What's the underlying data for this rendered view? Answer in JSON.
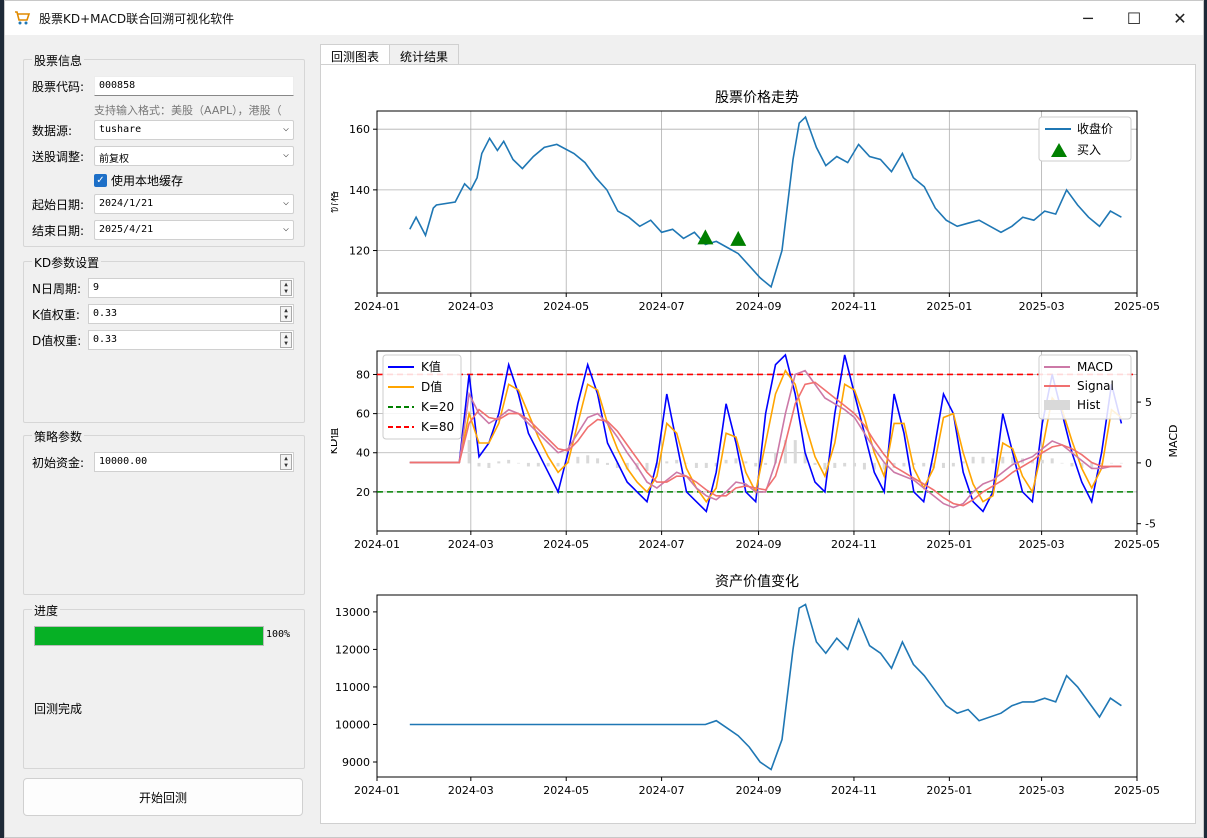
{
  "window": {
    "title": "股票KD+MACD联合回溯可视化软件",
    "minimize_icon": "minimize-icon",
    "maximize_icon": "maximize-icon",
    "close_icon": "close-icon"
  },
  "stock_info": {
    "group_title": "股票信息",
    "code_label": "股票代码:",
    "code_value": "000858",
    "hint": "支持输入格式：美股（AAPL），港股（",
    "source_label": "数据源:",
    "source_value": "tushare",
    "adjust_label": "送股调整:",
    "adjust_value": "前复权",
    "cache_label": "使用本地缓存",
    "cache_checked": true,
    "start_label": "起始日期:",
    "start_value": "2024/1/21",
    "end_label": "结束日期:",
    "end_value": "2025/4/21"
  },
  "kd_params": {
    "group_title": "KD参数设置",
    "n_label": "N日周期:",
    "n_value": "9",
    "k_label": "K值权重:",
    "k_value": "0.33",
    "d_label": "D值权重:",
    "d_value": "0.33"
  },
  "strategy": {
    "group_title": "策略参数",
    "capital_label": "初始资金:",
    "capital_value": "10000.00"
  },
  "progress": {
    "group_title": "进度",
    "percent": 100,
    "percent_text": "100%",
    "status": "回测完成"
  },
  "start_button": "开始回测",
  "tabs": [
    {
      "label": "回测图表",
      "active": true
    },
    {
      "label": "统计结果",
      "active": false
    }
  ],
  "chart_data": [
    {
      "type": "line",
      "title": "股票价格走势",
      "ylabel": "价格",
      "xlabel": "",
      "x_ticks": [
        "2024-01",
        "2024-03",
        "2024-05",
        "2024-07",
        "2024-09",
        "2024-11",
        "2025-01",
        "2025-03",
        "2025-05"
      ],
      "ylim": [
        106,
        166
      ],
      "y_ticks": [
        120,
        140,
        160
      ],
      "legend": {
        "placement": "top-right",
        "entries": [
          "收盘价",
          "买入"
        ]
      },
      "grid": true,
      "series": [
        {
          "name": "收盘价",
          "color": "#1f77b4",
          "x": [
            "2024-01-22",
            "2024-01-26",
            "2024-02-01",
            "2024-02-06",
            "2024-02-08",
            "2024-02-20",
            "2024-02-26",
            "2024-03-01",
            "2024-03-05",
            "2024-03-08",
            "2024-03-13",
            "2024-03-18",
            "2024-03-22",
            "2024-03-28",
            "2024-04-03",
            "2024-04-10",
            "2024-04-17",
            "2024-04-25",
            "2024-05-06",
            "2024-05-13",
            "2024-05-20",
            "2024-05-27",
            "2024-06-03",
            "2024-06-10",
            "2024-06-17",
            "2024-06-24",
            "2024-07-01",
            "2024-07-08",
            "2024-07-15",
            "2024-07-22",
            "2024-07-29",
            "2024-08-05",
            "2024-08-12",
            "2024-08-19",
            "2024-08-26",
            "2024-09-02",
            "2024-09-09",
            "2024-09-16",
            "2024-09-23",
            "2024-09-27",
            "2024-10-01",
            "2024-10-08",
            "2024-10-14",
            "2024-10-21",
            "2024-10-28",
            "2024-11-04",
            "2024-11-11",
            "2024-11-18",
            "2024-11-25",
            "2024-12-02",
            "2024-12-09",
            "2024-12-16",
            "2024-12-23",
            "2024-12-30",
            "2025-01-06",
            "2025-01-13",
            "2025-01-20",
            "2025-02-03",
            "2025-02-10",
            "2025-02-17",
            "2025-02-24",
            "2025-03-03",
            "2025-03-10",
            "2025-03-17",
            "2025-03-24",
            "2025-03-31",
            "2025-04-07",
            "2025-04-14",
            "2025-04-21"
          ],
          "y": [
            127,
            131,
            125,
            134,
            135,
            136,
            142,
            140,
            144,
            152,
            157,
            153,
            156,
            150,
            147,
            151,
            154,
            155,
            152,
            149,
            144,
            140,
            133,
            131,
            128,
            130,
            126,
            127,
            124,
            126,
            122,
            123,
            121,
            119,
            115,
            111,
            108,
            120,
            150,
            162,
            164,
            154,
            148,
            151,
            149,
            155,
            151,
            150,
            146,
            152,
            144,
            141,
            134,
            130,
            128,
            129,
            130,
            126,
            128,
            131,
            130,
            133,
            132,
            140,
            135,
            131,
            128,
            133,
            131
          ]
        }
      ],
      "markers": [
        {
          "name": "买入",
          "color": "#008000",
          "x": [
            "2024-07-29",
            "2024-08-19"
          ],
          "y": [
            124,
            123.5
          ]
        }
      ]
    },
    {
      "type": "line",
      "title": "",
      "ylabel": "KD值",
      "y2label": "MACD",
      "x_ticks": [
        "2024-01",
        "2024-03",
        "2024-05",
        "2024-07",
        "2024-09",
        "2024-11",
        "2025-01",
        "2025-03",
        "2025-05"
      ],
      "ylim": [
        0,
        92
      ],
      "y_ticks": [
        20,
        40,
        60,
        80
      ],
      "y2lim": [
        -5.6,
        9.2
      ],
      "y2_ticks": [
        -5,
        0,
        5
      ],
      "legend_left": [
        "K值",
        "D值",
        "K=20",
        "K=80"
      ],
      "legend_right": [
        "MACD",
        "Signal",
        "Hist"
      ],
      "grid": true,
      "hlines": [
        {
          "name": "K=20",
          "y": 20,
          "color": "#008000"
        },
        {
          "name": "K=80",
          "y": 80,
          "color": "#ff0000"
        }
      ],
      "series": [
        {
          "name": "K值",
          "color": "#0000ff",
          "y": [
            35,
            35,
            35,
            35,
            35,
            35,
            80,
            38,
            45,
            60,
            85,
            70,
            50,
            40,
            30,
            20,
            40,
            65,
            85,
            70,
            45,
            35,
            25,
            20,
            15,
            35,
            70,
            45,
            20,
            15,
            10,
            30,
            65,
            45,
            20,
            15,
            60,
            85,
            90,
            70,
            40,
            25,
            20,
            60,
            90,
            70,
            50,
            30,
            20,
            70,
            50,
            20,
            15,
            40,
            70,
            60,
            30,
            15,
            10,
            20,
            60,
            40,
            20,
            15,
            55,
            80,
            60,
            40,
            25,
            15,
            40,
            75,
            55
          ]
        },
        {
          "name": "D值",
          "color": "#ffa500",
          "y": [
            35,
            35,
            35,
            35,
            35,
            35,
            60,
            45,
            45,
            55,
            75,
            72,
            60,
            48,
            38,
            30,
            35,
            55,
            75,
            72,
            55,
            42,
            32,
            25,
            20,
            28,
            55,
            50,
            32,
            22,
            15,
            22,
            50,
            48,
            30,
            20,
            45,
            70,
            82,
            75,
            55,
            38,
            28,
            45,
            75,
            72,
            58,
            40,
            28,
            55,
            55,
            32,
            22,
            32,
            58,
            60,
            40,
            24,
            15,
            18,
            45,
            42,
            28,
            20,
            42,
            68,
            62,
            46,
            32,
            22,
            32,
            62,
            58
          ]
        },
        {
          "name": "MACD",
          "color": "#cc79a7",
          "y": [
            35,
            35,
            35,
            35,
            35,
            35,
            70,
            60,
            55,
            58,
            62,
            60,
            55,
            50,
            45,
            40,
            42,
            50,
            58,
            60,
            55,
            48,
            40,
            33,
            25,
            22,
            26,
            30,
            28,
            22,
            18,
            16,
            20,
            25,
            24,
            20,
            20,
            35,
            60,
            80,
            82,
            75,
            68,
            65,
            62,
            58,
            50,
            42,
            35,
            30,
            28,
            26,
            22,
            18,
            14,
            12,
            14,
            20,
            24,
            26,
            30,
            34,
            36,
            38,
            42,
            46,
            44,
            40,
            36,
            32,
            32,
            33,
            33
          ]
        },
        {
          "name": "Signal",
          "color": "#f07070",
          "y": [
            35,
            35,
            35,
            35,
            35,
            35,
            55,
            62,
            58,
            57,
            60,
            60,
            57,
            52,
            47,
            42,
            41,
            46,
            53,
            57,
            56,
            51,
            44,
            37,
            30,
            25,
            25,
            28,
            28,
            25,
            21,
            18,
            18,
            22,
            23,
            22,
            21,
            28,
            45,
            65,
            75,
            76,
            72,
            68,
            64,
            60,
            54,
            46,
            39,
            33,
            30,
            27,
            24,
            21,
            17,
            14,
            13,
            16,
            20,
            23,
            26,
            30,
            33,
            36,
            40,
            43,
            44,
            42,
            39,
            35,
            33,
            33,
            33
          ]
        }
      ]
    },
    {
      "type": "line",
      "title": "资产价值变化",
      "ylabel": "",
      "x_ticks": [
        "2024-01",
        "2024-03",
        "2024-05",
        "2024-07",
        "2024-09",
        "2024-11",
        "2025-01",
        "2025-03",
        "2025-05"
      ],
      "ylim": [
        8600,
        13450
      ],
      "y_ticks": [
        9000,
        10000,
        11000,
        12000,
        13000
      ],
      "grid": false,
      "series": [
        {
          "name": "资产",
          "color": "#1f77b4",
          "x": [
            "2024-01-22",
            "2024-07-29",
            "2024-08-05",
            "2024-08-12",
            "2024-08-19",
            "2024-08-26",
            "2024-09-02",
            "2024-09-09",
            "2024-09-16",
            "2024-09-23",
            "2024-09-27",
            "2024-10-01",
            "2024-10-08",
            "2024-10-14",
            "2024-10-21",
            "2024-10-28",
            "2024-11-04",
            "2024-11-11",
            "2024-11-18",
            "2024-11-25",
            "2024-12-02",
            "2024-12-09",
            "2024-12-16",
            "2024-12-23",
            "2024-12-30",
            "2025-01-06",
            "2025-01-13",
            "2025-01-20",
            "2025-02-03",
            "2025-02-10",
            "2025-02-17",
            "2025-02-24",
            "2025-03-03",
            "2025-03-10",
            "2025-03-17",
            "2025-03-24",
            "2025-03-31",
            "2025-04-07",
            "2025-04-14",
            "2025-04-21"
          ],
          "y": [
            10000,
            10000,
            10100,
            9900,
            9700,
            9400,
            9000,
            8800,
            9600,
            12000,
            13100,
            13200,
            12200,
            11900,
            12300,
            12000,
            12800,
            12100,
            11900,
            11500,
            12200,
            11600,
            11300,
            10900,
            10500,
            10300,
            10400,
            10100,
            10300,
            10500,
            10600,
            10600,
            10700,
            10600,
            11300,
            11000,
            10600,
            10200,
            10700,
            10500
          ]
        }
      ]
    }
  ]
}
